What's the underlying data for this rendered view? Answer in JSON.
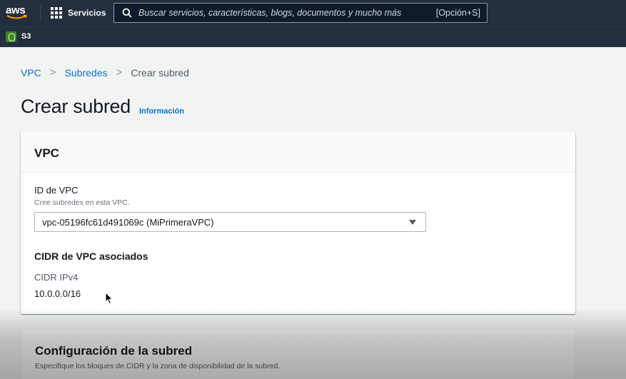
{
  "topbar": {
    "logo_text": "aws",
    "services_label": "Servicios",
    "search_placeholder": "Buscar servicios, características, blogs, documentos y mucho más",
    "search_shortcut": "[Opción+S]"
  },
  "favorites": [
    {
      "label": "S3",
      "color": "#3f8624"
    }
  ],
  "breadcrumb": {
    "items": [
      "VPC",
      "Subredes"
    ],
    "current": "Crear subred",
    "separator": ">"
  },
  "page": {
    "title": "Crear subred",
    "info_link": "Información"
  },
  "vpc_section": {
    "header": "VPC",
    "vpc_id_label": "ID de VPC",
    "vpc_id_description": "Cree subredes en esta VPC.",
    "vpc_id_selected": "vpc-05196fc61d491069c (MiPrimeraVPC)",
    "cidr_heading": "CIDR de VPC asociados",
    "cidr_key": "CIDR IPv4",
    "cidr_value": "10.0.0.0/16"
  },
  "subnet_config": {
    "header": "Configuración de la subred",
    "description": "Especifique los bloques de CIDR y la zona de disponibilidad de la subred."
  },
  "colors": {
    "nav_bg": "#232f3e",
    "link": "#0972d3",
    "page_bg": "#f2f3f3"
  }
}
